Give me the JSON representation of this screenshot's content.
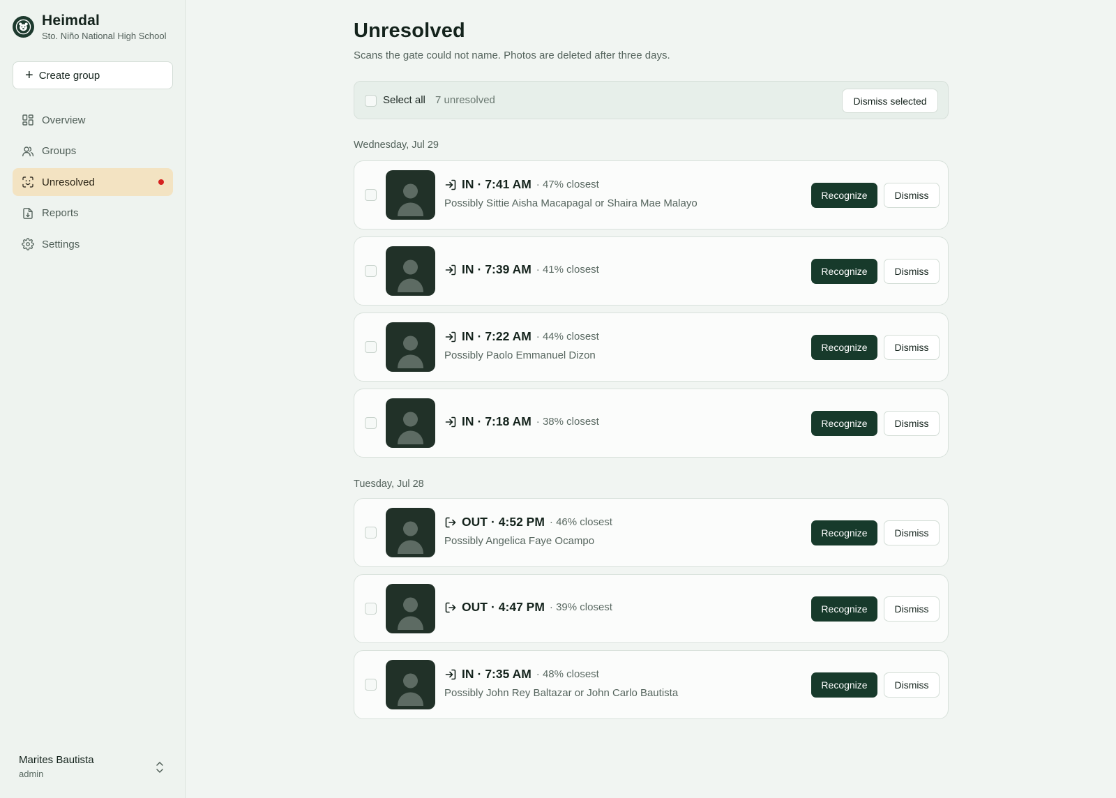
{
  "brand": {
    "title": "Heimdal",
    "subtitle": "Sto. Niño National High School",
    "logo_icon": "bear-face-icon"
  },
  "sidebar": {
    "create_label": "Create group",
    "items": [
      {
        "label": "Overview",
        "icon": "grid-icon",
        "active": false
      },
      {
        "label": "Groups",
        "icon": "users-icon",
        "active": false
      },
      {
        "label": "Unresolved",
        "icon": "face-scan-icon",
        "active": true,
        "badge_color": "#d6211f"
      },
      {
        "label": "Reports",
        "icon": "file-download-icon",
        "active": false
      },
      {
        "label": "Settings",
        "icon": "gear-icon",
        "active": false
      }
    ]
  },
  "user": {
    "name": "Marites Bautista",
    "role": "admin"
  },
  "page": {
    "title": "Unresolved",
    "subtitle": "Scans the gate could not name. Photos are deleted after three days."
  },
  "select_bar": {
    "select_all_label": "Select all",
    "count_label": "7 unresolved",
    "dismiss_selected_label": "Dismiss selected"
  },
  "actions": {
    "recognize_label": "Recognize",
    "dismiss_label": "Dismiss"
  },
  "days": [
    {
      "label": "Wednesday, Jul 29",
      "rows": [
        {
          "direction": "IN",
          "time": "7:41 AM",
          "closest": "· 47% closest",
          "possibly": "Possibly Sittie Aisha Macapagal or Shaira Mae Malayo"
        },
        {
          "direction": "IN",
          "time": "7:39 AM",
          "closest": "· 41% closest",
          "possibly": ""
        },
        {
          "direction": "IN",
          "time": "7:22 AM",
          "closest": "· 44% closest",
          "possibly": "Possibly Paolo Emmanuel Dizon"
        },
        {
          "direction": "IN",
          "time": "7:18 AM",
          "closest": "· 38% closest",
          "possibly": ""
        }
      ]
    },
    {
      "label": "Tuesday, Jul 28",
      "rows": [
        {
          "direction": "OUT",
          "time": "4:52 PM",
          "closest": "· 46% closest",
          "possibly": "Possibly Angelica Faye Ocampo"
        },
        {
          "direction": "OUT",
          "time": "4:47 PM",
          "closest": "· 39% closest",
          "possibly": ""
        },
        {
          "direction": "IN",
          "time": "7:35 AM",
          "closest": "· 48% closest",
          "possibly": "Possibly John Rey Baltazar or John Carlo Bautista"
        }
      ]
    }
  ],
  "colors": {
    "accent_dark_green": "#173a2b",
    "active_nav_bg": "#f3e3c2",
    "alert_dot": "#d6211f",
    "page_bg": "#f1f5f2"
  }
}
